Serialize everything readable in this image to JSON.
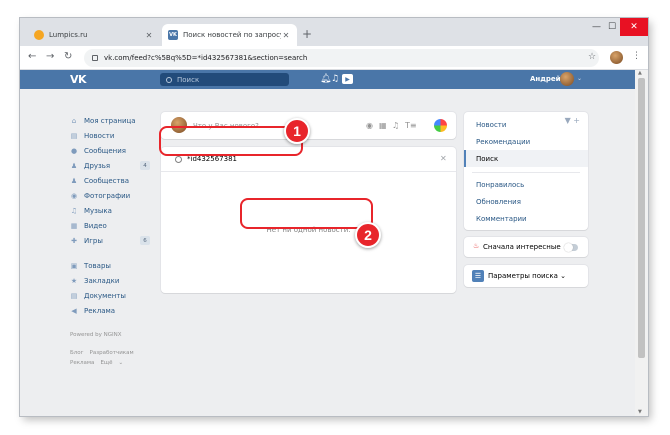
{
  "browser": {
    "tabs": [
      {
        "title": "Lumpics.ru",
        "active": false
      },
      {
        "title": "Поиск новостей по запросу \"id",
        "active": true
      }
    ],
    "url": "vk.com/feed?c%5Bq%5D=*id432567381&section=search"
  },
  "header": {
    "logo": "VK",
    "search_placeholder": "Поиск",
    "username": "Андрей"
  },
  "sidebar": {
    "items": [
      {
        "label": "Моя страница",
        "icon": "home-icon"
      },
      {
        "label": "Новости",
        "icon": "news-icon"
      },
      {
        "label": "Сообщения",
        "icon": "message-icon"
      },
      {
        "label": "Друзья",
        "icon": "friends-icon",
        "count": "4"
      },
      {
        "label": "Сообщества",
        "icon": "communities-icon"
      },
      {
        "label": "Фотографии",
        "icon": "camera-icon"
      },
      {
        "label": "Музыка",
        "icon": "music-icon"
      },
      {
        "label": "Видео",
        "icon": "video-icon"
      },
      {
        "label": "Игры",
        "icon": "games-icon",
        "count": "6"
      },
      {
        "label": "Товары",
        "icon": "bag-icon"
      },
      {
        "label": "Закладки",
        "icon": "star-icon"
      },
      {
        "label": "Документы",
        "icon": "document-icon"
      },
      {
        "label": "Реклама",
        "icon": "ads-icon"
      }
    ],
    "powered": "Powered by NGINX",
    "footer_links": [
      "Блог",
      "Разработчикам",
      "Реклама",
      "Ещё"
    ]
  },
  "composer": {
    "placeholder": "Что у Вас нового?"
  },
  "search": {
    "query": "*id432567381",
    "empty_message": "Нет ни одной новости."
  },
  "right_menu": {
    "items": [
      "Новости",
      "Рекомендации",
      "Поиск",
      "Понравилось",
      "Обновления",
      "Комментарии"
    ],
    "selected": "Поиск"
  },
  "interesting_first": {
    "label": "Сначала интересные",
    "enabled": false
  },
  "search_params": {
    "label": "Параметры поиска"
  },
  "annotations": {
    "badge1": "1",
    "badge2": "2"
  },
  "colors": {
    "vk_blue": "#4a76a8",
    "link": "#2a5885",
    "annotation_red": "#e8252b"
  }
}
